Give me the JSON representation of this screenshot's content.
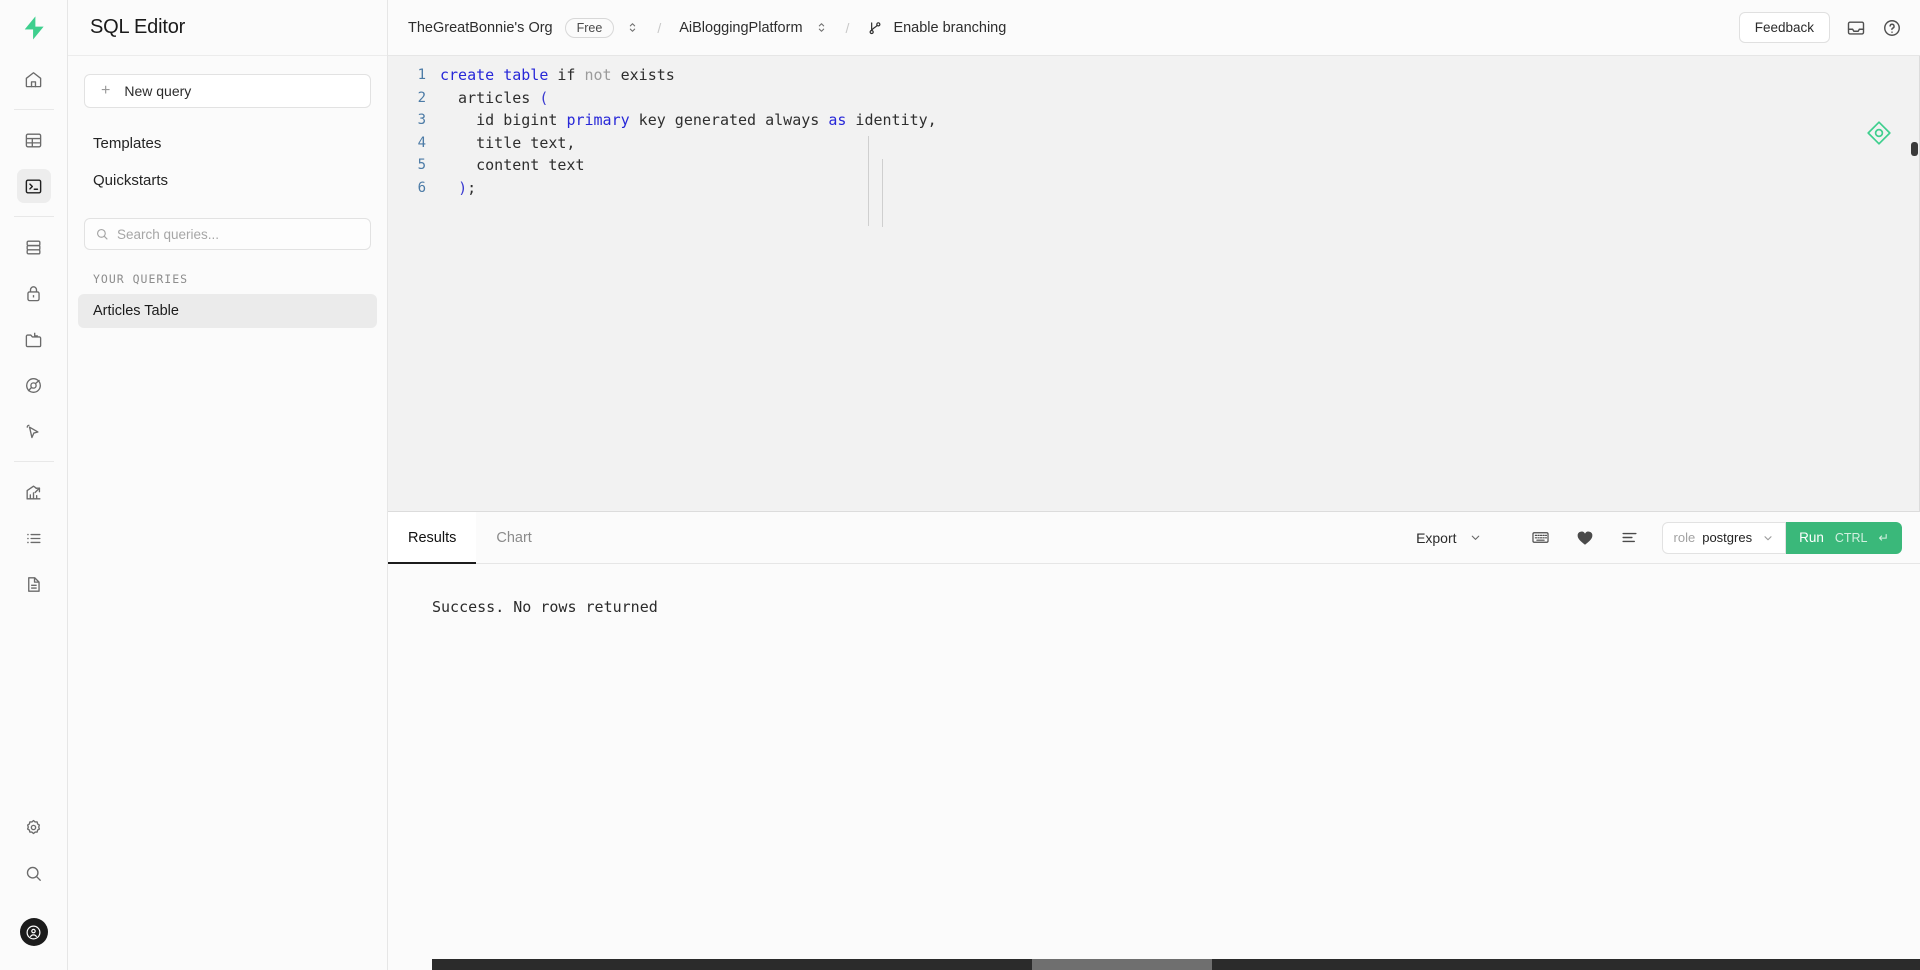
{
  "sidebar": {
    "title": "SQL Editor",
    "new_query_label": "New query",
    "nav": [
      {
        "label": "Templates",
        "name": "templates"
      },
      {
        "label": "Quickstarts",
        "name": "quickstarts"
      }
    ],
    "search_placeholder": "Search queries...",
    "queries_section_label": "YOUR QUERIES",
    "queries": [
      {
        "label": "Articles Table",
        "selected": true
      }
    ]
  },
  "rail": {
    "logo": "supabase-logo",
    "items": [
      {
        "name": "home-icon",
        "active": false
      },
      {
        "name": "table-editor-icon",
        "active": false
      },
      {
        "name": "sql-editor-icon",
        "active": true
      },
      {
        "name": "database-icon",
        "active": false
      },
      {
        "name": "auth-lock-icon",
        "active": false
      },
      {
        "name": "storage-folder-icon",
        "active": false
      },
      {
        "name": "edge-functions-icon",
        "active": false
      },
      {
        "name": "realtime-cursor-icon",
        "active": false
      },
      {
        "name": "reports-chart-icon",
        "active": false
      },
      {
        "name": "logs-list-icon",
        "active": false
      },
      {
        "name": "api-docs-icon",
        "active": false
      },
      {
        "name": "settings-gear-icon",
        "active": false
      },
      {
        "name": "search-icon",
        "active": false
      }
    ],
    "avatar": "user-avatar"
  },
  "topbar": {
    "org_name": "TheGreatBonnie's Org",
    "plan_badge": "Free",
    "separator": "/",
    "project_name": "AiBloggingPlatform",
    "branching_label": "Enable branching",
    "feedback_label": "Feedback",
    "inbox_icon": "inbox-icon",
    "help_icon": "help-circle-icon"
  },
  "editor": {
    "ai_assistant_icon": "ai-diamond-icon",
    "lines": [
      {
        "num": "1",
        "tokens": [
          {
            "t": "create table",
            "c": "kw"
          },
          {
            "t": " if ",
            "c": ""
          },
          {
            "t": "not",
            "c": "kw-dim"
          },
          {
            "t": " exists",
            "c": ""
          }
        ]
      },
      {
        "num": "2",
        "tokens": [
          {
            "t": "  articles ",
            "c": ""
          },
          {
            "t": "(",
            "c": "punct"
          }
        ]
      },
      {
        "num": "3",
        "tokens": [
          {
            "t": "    id bigint ",
            "c": ""
          },
          {
            "t": "primary",
            "c": "kw"
          },
          {
            "t": " key generated always ",
            "c": ""
          },
          {
            "t": "as",
            "c": "kw"
          },
          {
            "t": " identity,",
            "c": ""
          }
        ]
      },
      {
        "num": "4",
        "tokens": [
          {
            "t": "    title text,",
            "c": ""
          }
        ]
      },
      {
        "num": "5",
        "tokens": [
          {
            "t": "    content text",
            "c": ""
          }
        ]
      },
      {
        "num": "6",
        "tokens": [
          {
            "t": "  ",
            "c": ""
          },
          {
            "t": ")",
            "c": "punct"
          },
          {
            "t": ";",
            "c": ""
          }
        ]
      }
    ]
  },
  "results": {
    "tabs": [
      {
        "label": "Results",
        "active": true
      },
      {
        "label": "Chart",
        "active": false
      }
    ],
    "export_label": "Export",
    "keyboard_icon": "keyboard-icon",
    "favorite_icon": "heart-filled-icon",
    "format_icon": "format-lines-icon",
    "role_key": "role",
    "role_value": "postgres",
    "run_label": "Run",
    "run_hint": "CTRL",
    "run_enter": "↵",
    "message": "Success. No rows returned"
  },
  "colors": {
    "accent_green": "#3ab87a",
    "keyword_blue": "#2727d8",
    "line_number": "#4c7ba6"
  }
}
